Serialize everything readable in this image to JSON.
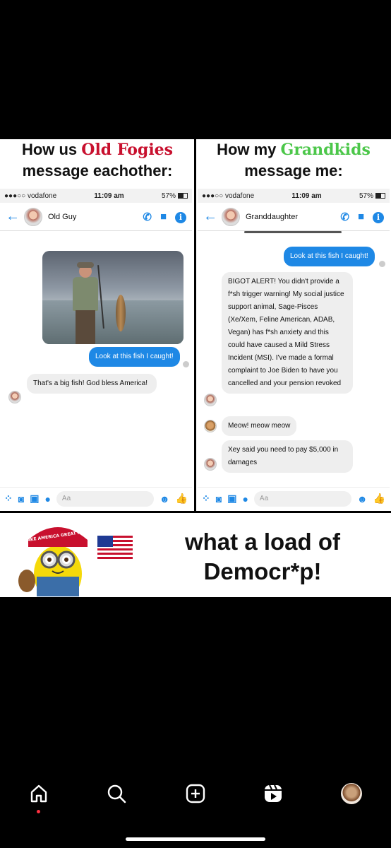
{
  "meme": {
    "left_header": {
      "line1_pre": "How us ",
      "line1_highlight": "Old Fogies",
      "line2": "message eachother:"
    },
    "right_header": {
      "line1_pre": "How my ",
      "line1_highlight": "Grandkids",
      "line2": "message me:"
    },
    "left_phone": {
      "status": {
        "carrier": "●●●○○ vodafone",
        "time": "11:09 am",
        "battery": "57%"
      },
      "contact_name": "Old Guy",
      "messages": {
        "outgoing": "Look at this fish I caught!",
        "incoming": "That's a big fish! God bless America!"
      },
      "composer_placeholder": "Aa"
    },
    "right_phone": {
      "status": {
        "carrier": "●●●○○ vodafone",
        "time": "11:09 am",
        "battery": "57%"
      },
      "contact_name": "Granddaughter",
      "messages": {
        "outgoing": "Look at this fish I caught!",
        "incoming1": "BIGOT ALERT! You didn't provide a f*sh trigger warning! My social justice support animal, Sage-Pisces (Xe/Xem, Feline American, ADAB, Vegan) has f*sh anxiety and this could have caused a Mild Stress Incident (MSI). I've made a formal complaint to Joe Biden to have you cancelled and your pension revoked",
        "incoming2": "Meow! meow meow",
        "incoming3": "Xey said you need to pay $5,000 in damages"
      },
      "composer_placeholder": "Aa"
    },
    "caption": "what a load of Democr*p!",
    "hat_text": "MAKE AMERICA GREAT AGAIN"
  },
  "tabbar": {
    "icons": [
      "home-icon",
      "search-icon",
      "create-icon",
      "reels-icon",
      "profile-avatar"
    ]
  },
  "colors": {
    "accent": "#1e88e5",
    "red_highlight": "#c8102e",
    "green_highlight": "#4cc74a"
  }
}
